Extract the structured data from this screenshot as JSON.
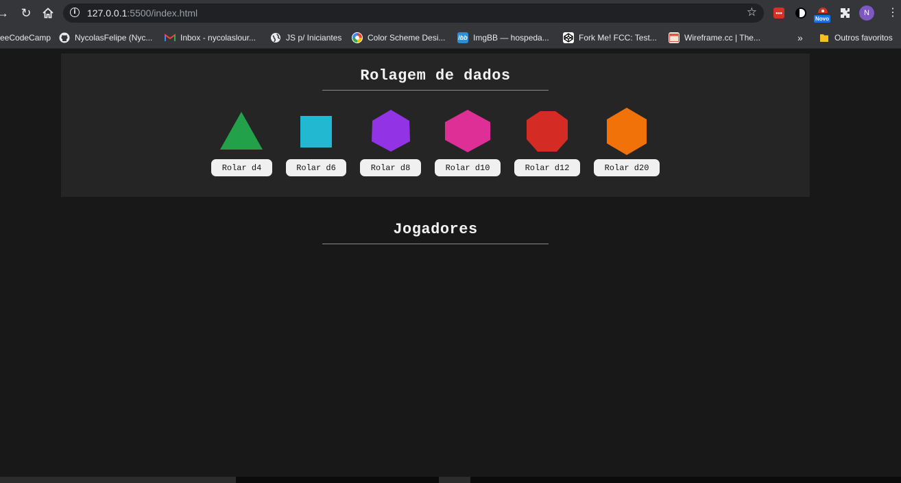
{
  "browser": {
    "url_host": "127.0.0.1",
    "url_rest": ":5500/index.html",
    "bookmarks": [
      {
        "label": "eeCodeCamp",
        "icon": "freecodecamp-icon"
      },
      {
        "label": "NycolasFelipe (Nyc...",
        "icon": "github-icon"
      },
      {
        "label": "Inbox - nycolaslour...",
        "icon": "gmail-icon"
      },
      {
        "label": "JS p/ Iniciantes",
        "icon": "globe-icon"
      },
      {
        "label": "Color Scheme Desi...",
        "icon": "colorscheme-icon"
      },
      {
        "label": "ImgBB — hospeda...",
        "icon": "imgbb-icon"
      },
      {
        "label": "Fork Me! FCC: Test...",
        "icon": "codepen-icon"
      },
      {
        "label": "Wireframe.cc | The...",
        "icon": "wireframe-icon"
      }
    ],
    "bookmarks_overflow": "»",
    "other_bookmarks": "Outros favoritos",
    "extension_badge": "Novo",
    "profile_initial": "N"
  },
  "dice_section": {
    "title": "Rolagem de dados",
    "dice": [
      {
        "shape": "triangle",
        "color": "#22a14a",
        "button": "Rolar d4"
      },
      {
        "shape": "square",
        "color": "#22b8d1",
        "button": "Rolar d6"
      },
      {
        "shape": "hexagon-vertical",
        "color": "#9333e6",
        "button": "Rolar d8"
      },
      {
        "shape": "hexagon-horizontal",
        "color": "#de2f96",
        "button": "Rolar d10"
      },
      {
        "shape": "octagon",
        "color": "#d52b25",
        "button": "Rolar d12"
      },
      {
        "shape": "hexagon-vertical",
        "color": "#f07208",
        "button": "Rolar d20"
      }
    ]
  },
  "players_section": {
    "title": "Jogadores"
  },
  "colors": {
    "page_bg": "#181818",
    "panel_bg": "#252525",
    "button_bg": "#f0f0f0"
  }
}
